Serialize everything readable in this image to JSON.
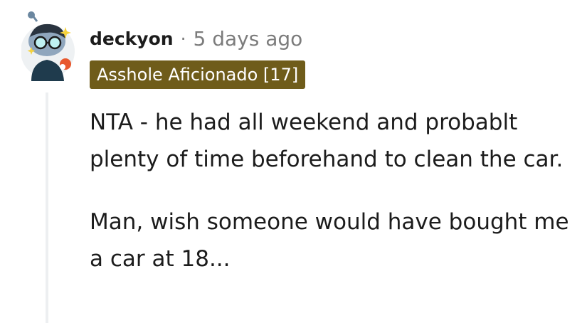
{
  "comment": {
    "author": "deckyon",
    "separator": "·",
    "timestamp": "5 days ago",
    "flair": {
      "text": "Asshole Aficionado [17]",
      "background_color": "#6f5c1a",
      "text_color": "#ffffff"
    },
    "avatar_icon": "snoo-avatar-icon",
    "paragraphs": [
      "NTA - he had all weekend and probablt plenty of time beforehand to clean the car.",
      "Man, wish someone would have bought me a car at 18..."
    ]
  }
}
